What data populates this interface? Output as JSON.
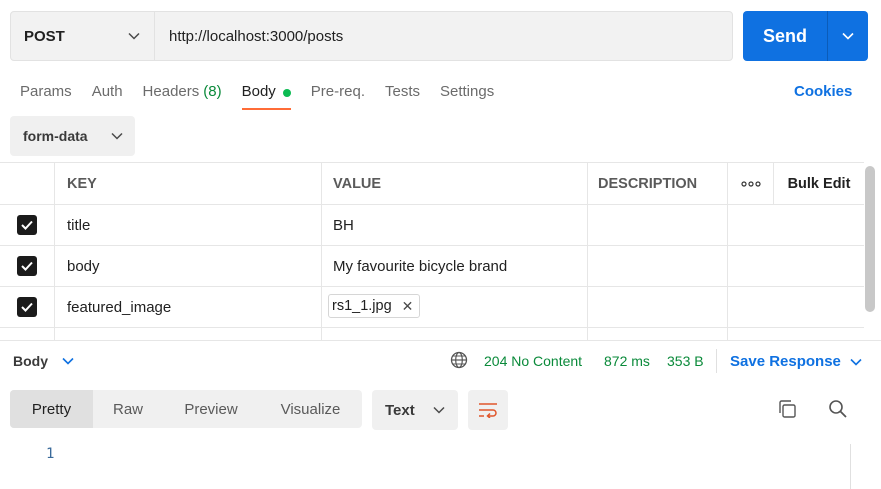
{
  "request": {
    "method": "POST",
    "url": "http://localhost:3000/posts",
    "send_label": "Send"
  },
  "tabs": [
    {
      "label": "Params"
    },
    {
      "label": "Auth"
    },
    {
      "label": "Headers",
      "count": "(8)"
    },
    {
      "label": "Body"
    },
    {
      "label": "Pre-req."
    },
    {
      "label": "Tests"
    },
    {
      "label": "Settings"
    }
  ],
  "cookies_label": "Cookies",
  "body_type": "form-data",
  "table": {
    "headers": {
      "key": "KEY",
      "value": "VALUE",
      "description": "DESCRIPTION",
      "more": "ooo",
      "bulk_edit": "Bulk Edit"
    },
    "rows": [
      {
        "key": "title",
        "value": "BH",
        "description": ""
      },
      {
        "key": "body",
        "value": "My favourite bicycle brand",
        "description": ""
      },
      {
        "key": "featured_image",
        "file": "rs1_1.jpg",
        "description": ""
      }
    ]
  },
  "response": {
    "title": "Body",
    "status": "204 No Content",
    "time": "872 ms",
    "size": "353 B",
    "save_label": "Save Response"
  },
  "view_tabs": [
    {
      "label": "Pretty"
    },
    {
      "label": "Raw"
    },
    {
      "label": "Preview"
    },
    {
      "label": "Visualize"
    }
  ],
  "format": "Text",
  "editor": {
    "line": "1"
  },
  "colors": {
    "accent": "#0f71e1",
    "tab_indicator": "#ff6c37",
    "success": "#0a8a3a",
    "dot": "#0cbb52"
  }
}
